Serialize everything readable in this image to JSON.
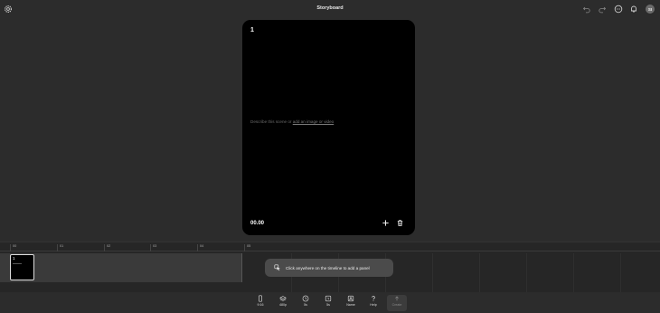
{
  "header": {
    "title": "Storyboard",
    "avatar_initials": "SI",
    "icons": [
      "gear-icon",
      "undo-icon",
      "redo-icon",
      "comment-icon",
      "bell-icon"
    ]
  },
  "panel": {
    "number": "1",
    "description_prefix": "Describe this scene or",
    "description_link": "add an image or video",
    "time": "00.00"
  },
  "timeline": {
    "ticks": [
      "00",
      "01",
      "02",
      "03",
      "04",
      "05"
    ],
    "thumb_number": "1",
    "hint": "Click anywhere on the timeline to add a panel"
  },
  "toolbar": {
    "items": [
      {
        "label": "9:16",
        "icon": "phone-icon"
      },
      {
        "label": "480p",
        "icon": "layers-icon"
      },
      {
        "label": "5s",
        "icon": "clock-icon"
      },
      {
        "label": "5s",
        "icon": "timer-icon"
      },
      {
        "label": "Name",
        "icon": "name-icon"
      },
      {
        "label": "Help",
        "icon": "help-icon"
      },
      {
        "label": "Create",
        "icon": "upload-icon"
      }
    ]
  }
}
